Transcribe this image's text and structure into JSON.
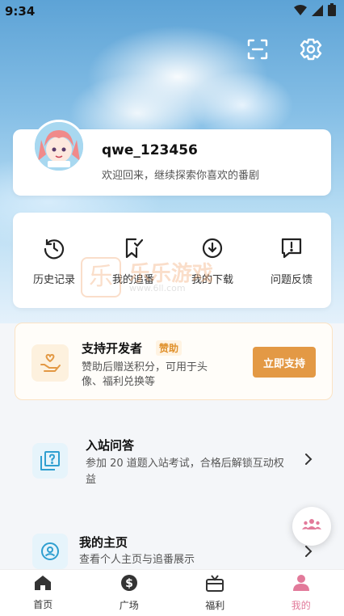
{
  "status_bar": {
    "time": "9:34"
  },
  "profile": {
    "username": "qwe_123456",
    "welcome": "欢迎回来，继续探索你喜欢的番剧"
  },
  "quick_actions": [
    {
      "label": "历史记录",
      "icon": "history-icon"
    },
    {
      "label": "我的追番",
      "icon": "bookmark-check-icon"
    },
    {
      "label": "我的下载",
      "icon": "download-icon"
    },
    {
      "label": "问题反馈",
      "icon": "feedback-icon"
    }
  ],
  "sponsor": {
    "title": "支持开发者",
    "badge": "赞助",
    "description": "赞助后赠送积分，可用于头像、福利兑换等",
    "button": "立即支持"
  },
  "list": [
    {
      "title": "入站问答",
      "description": "参加 20 道题入站考试，合格后解锁互动权益",
      "icon": "quiz-icon"
    },
    {
      "title": "我的主页",
      "description": "查看个人主页与追番展示",
      "icon": "user-circle-icon"
    }
  ],
  "watermark": {
    "name": "乐乐游戏",
    "url": "www.6ll.com"
  },
  "tabs": [
    {
      "label": "首页",
      "icon": "home-icon",
      "active": false
    },
    {
      "label": "广场",
      "icon": "dollar-icon",
      "active": false
    },
    {
      "label": "福利",
      "icon": "gift-icon",
      "active": false
    },
    {
      "label": "我的",
      "icon": "user-icon",
      "active": true
    }
  ],
  "colors": {
    "accent": "#e27a9a",
    "sponsor_button": "#e39945",
    "sponsor_badge": "#e0902a",
    "icon_blue": "#2f9fd0"
  }
}
